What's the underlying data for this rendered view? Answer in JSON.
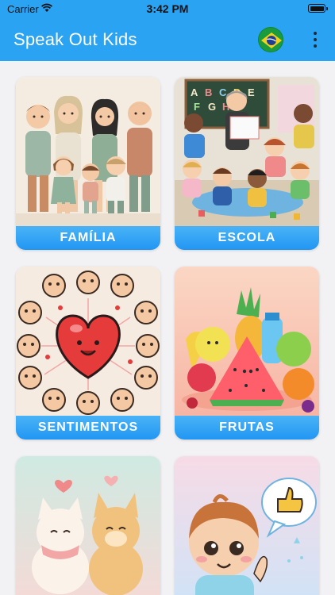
{
  "status_bar": {
    "carrier": "Carrier",
    "time": "3:42 PM"
  },
  "app_bar": {
    "title": "Speak Out Kids",
    "language_icon": "brazil-flag-icon",
    "menu_icon": "more-vertical-icon"
  },
  "categories": [
    {
      "label": "FAMÍLIA"
    },
    {
      "label": "ESCOLA"
    },
    {
      "label": "SENTIMENTOS"
    },
    {
      "label": "FRUTAS"
    },
    {
      "label": ""
    },
    {
      "label": ""
    }
  ],
  "colors": {
    "app_bar": "#2aa3f3",
    "label_bar": "#2196f3",
    "background": "#f2f2f4"
  }
}
